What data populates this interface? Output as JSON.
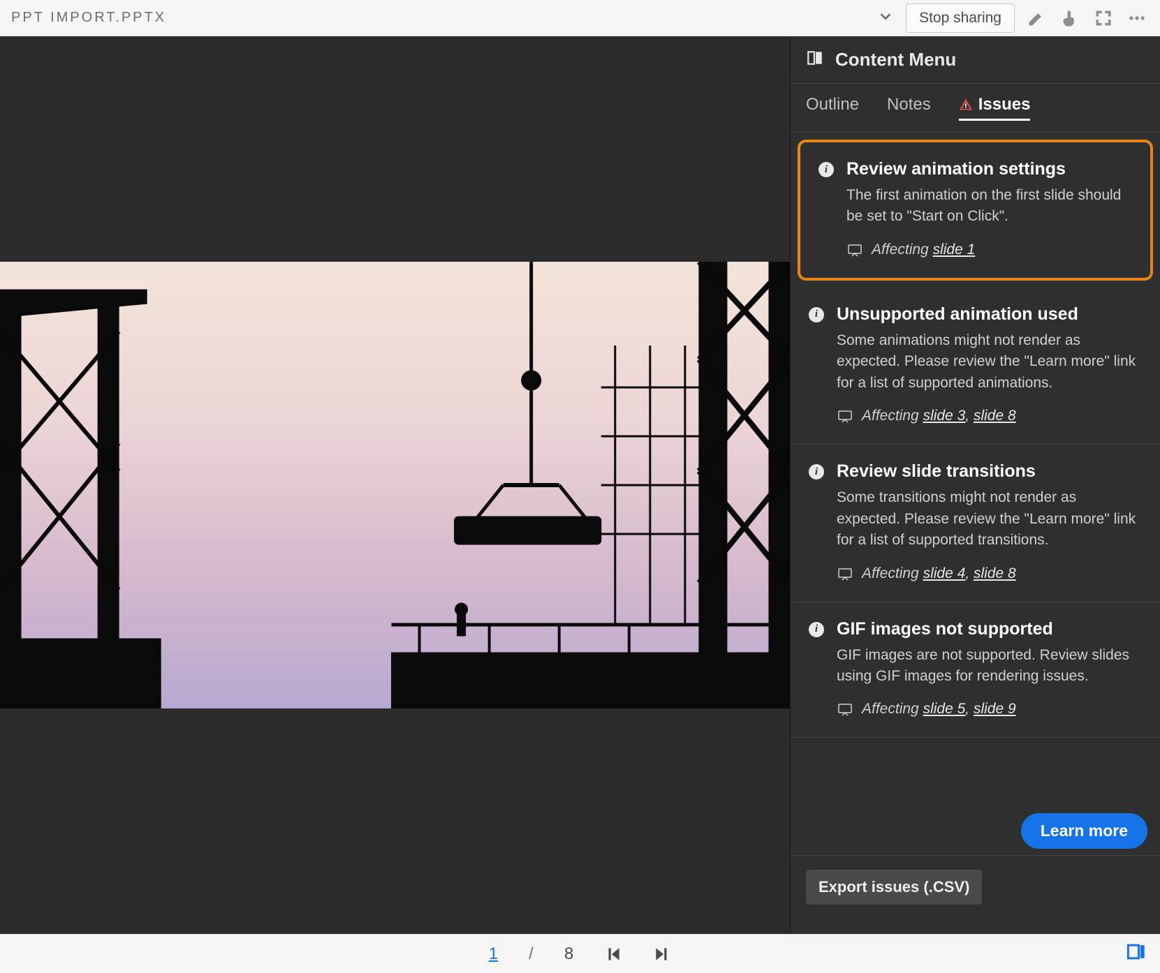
{
  "header": {
    "file_title": "PPT IMPORT.PPTX",
    "stop_sharing": "Stop sharing"
  },
  "panel": {
    "title": "Content Menu",
    "tabs": {
      "outline": "Outline",
      "notes": "Notes",
      "issues": "Issues"
    }
  },
  "issues": [
    {
      "title": "Review animation settings",
      "desc": "The first animation on the first slide should be set to \"Start on Click\".",
      "affecting_label": "Affecting ",
      "links_text": "slide 1",
      "links": [
        "slide 1"
      ],
      "highlight": true
    },
    {
      "title": "Unsupported animation used",
      "desc": "Some animations might not render as expected. Please review the \"Learn more\" link for a list of supported animations.",
      "affecting_label": "Affecting ",
      "links_text": "slide 3, slide 8",
      "links": [
        "slide 3",
        "slide 8"
      ],
      "highlight": false
    },
    {
      "title": "Review slide transitions",
      "desc": "Some transitions might not render as expected. Please review the \"Learn more\" link for a list of supported transitions.",
      "affecting_label": "Affecting ",
      "links_text": "slide 4, slide 8",
      "links": [
        "slide 4",
        "slide 8"
      ],
      "highlight": false
    },
    {
      "title": "GIF images not supported",
      "desc": "GIF images are not supported. Review slides using GIF images for rendering issues.",
      "affecting_label": "Affecting ",
      "links_text": "slide 5, slide 9",
      "links": [
        "slide 5",
        "slide 9"
      ],
      "highlight": false
    }
  ],
  "actions": {
    "learn_more": "Learn more",
    "export": "Export issues (.CSV)"
  },
  "pager": {
    "current": "1",
    "sep": "/",
    "total": "8"
  }
}
